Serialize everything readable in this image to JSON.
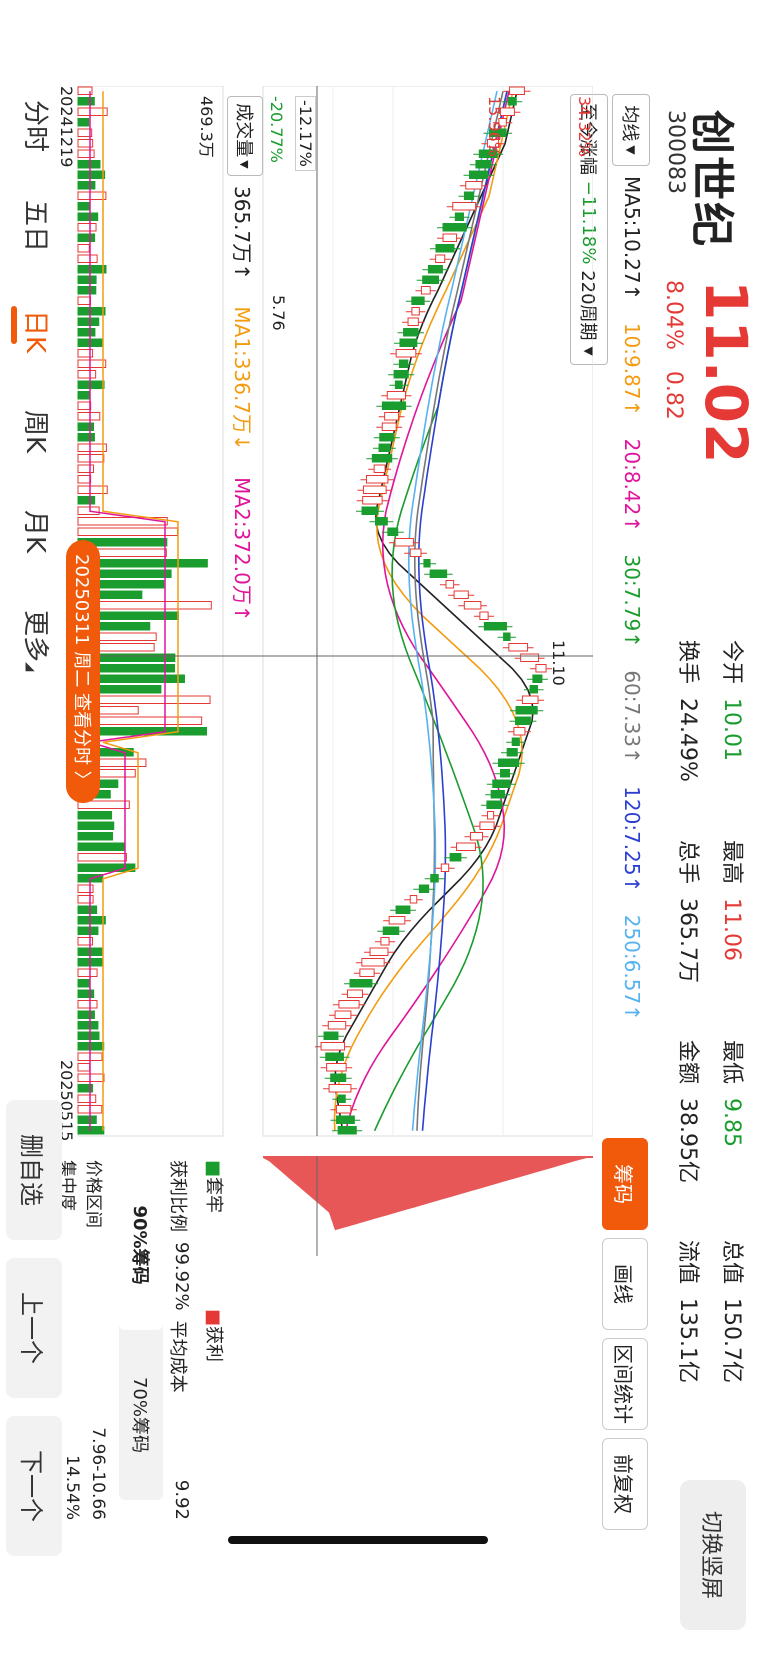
{
  "header": {
    "name": "创世纪",
    "code": "300083",
    "price": "11.02",
    "change_pct": "8.04%",
    "change_val": "0.82",
    "quote_pairs": [
      {
        "label": "今开",
        "value": "10.01"
      },
      {
        "label": "最高",
        "value": "11.06"
      },
      {
        "label": "最低",
        "value": "9.85"
      },
      {
        "label": "总值",
        "value": "150.7亿"
      },
      {
        "label": "换手",
        "value": "24.49%"
      },
      {
        "label": "总手",
        "value": "365.7万"
      },
      {
        "label": "金额",
        "value": "38.95亿"
      },
      {
        "label": "流值",
        "value": "135.1亿"
      }
    ],
    "switch_label": "切换竖屏"
  },
  "ma_legend": {
    "select_label": "均线",
    "items": [
      {
        "text": "MA5:10.27↑",
        "color": "#222222"
      },
      {
        "text": "10:9.87↑",
        "color": "#f39c12"
      },
      {
        "text": "20:8.42↑",
        "color": "#e0149b"
      },
      {
        "text": "30:7.79↑",
        "color": "#1a9c2e"
      },
      {
        "text": "60:7.33↑",
        "color": "#777777"
      },
      {
        "text": "120:7.25↑",
        "color": "#2b3fd1"
      },
      {
        "text": "250:6.57↑",
        "color": "#56b3f0"
      }
    ],
    "range_label": "至今涨幅",
    "range_value": "−11.18%",
    "period": "220周期"
  },
  "price_axis": {
    "top_labels": [
      "34.32%",
      "15.96%"
    ],
    "bottom_labels": [
      "-12.17%",
      "-20.77%"
    ],
    "low_marker": "5.76",
    "hi_marker": "11.10"
  },
  "chip_tabs": [
    "筹码",
    "画线",
    "区间统计",
    "前复权"
  ],
  "volume": {
    "select_label": "成交量",
    "current": "365.7万↑",
    "ma1": "MA1:336.7万↓",
    "ma2": "MA2:372.0万↑",
    "max_label": "469.3万",
    "start_date": "20241219",
    "end_date": "20250515",
    "date_pill": "20250311 周二 查看分时 〉"
  },
  "chips": {
    "legend_trapped": "套牢",
    "legend_profit": "获利",
    "profit_ratio_label": "获利比例",
    "profit_ratio": "99.92%",
    "avg_cost_label": "平均成本",
    "avg_cost": "9.92",
    "tab_90": "90%筹码",
    "tab_70": "70%筹码",
    "range_label": "价格区间",
    "range_value": "7.96-10.66",
    "conc_label": "集中度",
    "conc_value": "14.54%"
  },
  "bottom_nav": [
    "分时",
    "五日",
    "日K",
    "周K",
    "月K",
    "更多"
  ],
  "actions": [
    "删自选",
    "上一个",
    "下一个"
  ],
  "colors": {
    "accent": "#f05a0a",
    "up": "#e53935",
    "down": "#1a9c2e"
  }
}
